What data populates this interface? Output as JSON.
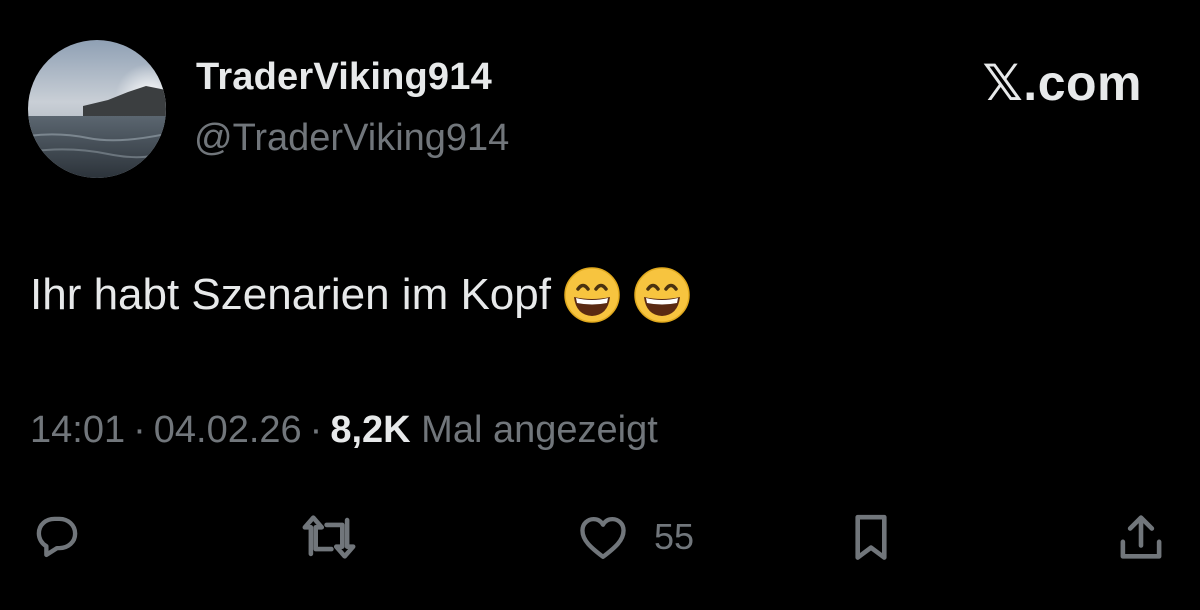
{
  "author": {
    "display_name": "TraderViking914",
    "handle": "@TraderViking914"
  },
  "brand": {
    "label": "𝕏.com"
  },
  "tweet": {
    "text": "Ihr habt Szenarien im Kopf",
    "emojis": [
      "grinning-face-with-smiling-eyes",
      "grinning-face-with-smiling-eyes"
    ]
  },
  "meta": {
    "time": "14:01",
    "separator": "·",
    "date": "04.02.26",
    "views_count": "8,2K",
    "views_label": "Mal angezeigt"
  },
  "actions": {
    "reply_icon": "speech-bubble",
    "retweet_icon": "arrows-loop",
    "like_icon": "heart",
    "like_count": "55",
    "bookmark_icon": "bookmark",
    "share_icon": "upload-arrow"
  },
  "colors": {
    "background": "#000000",
    "primary_text": "#e7e9ea",
    "secondary_text": "#71767b"
  }
}
